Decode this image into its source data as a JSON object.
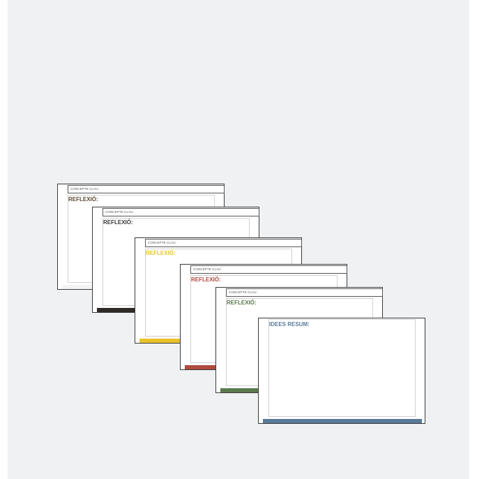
{
  "cards": [
    {
      "concept_label": "CONCEPTE CLAU:",
      "heading": "REFLEXIÓ:",
      "color": "#5a4b32",
      "bar_color": "#f4f4f4"
    },
    {
      "concept_label": "CONCEPTE CLAU:",
      "heading": "REFLEXIÓ:",
      "color": "#3a3a3a",
      "bar_color": "#2e2a26"
    },
    {
      "concept_label": "CONCEPTE CLAU:",
      "heading": "REFLEXIÓ:",
      "color": "#e8c32a",
      "bar_color": "#e8c32a"
    },
    {
      "concept_label": "CONCEPTE CLAU:",
      "heading": "REFLEXIÓ:",
      "color": "#b04a3e",
      "bar_color": "#b04a3e"
    },
    {
      "concept_label": "CONCEPTE CLAU:",
      "heading": "REFLEXIÓ:",
      "color": "#5b7a4e",
      "bar_color": "#5b7a4e"
    },
    {
      "heading": "IDEES RESUM:",
      "color": "#5a7a9a",
      "bar_color": "#5a7a9a"
    }
  ]
}
